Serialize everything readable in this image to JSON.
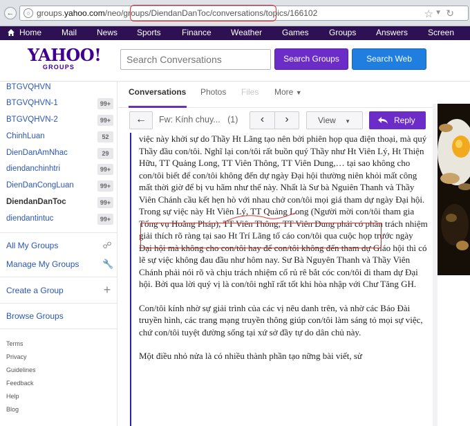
{
  "browser": {
    "url_prefix": "groups.",
    "url_domain": "yahoo.com",
    "url_suffix": "/neo/groups/DiendanDanToc/conversations/topics/166102"
  },
  "topnav": {
    "items": [
      "Home",
      "Mail",
      "News",
      "Sports",
      "Finance",
      "Weather",
      "Games",
      "Groups",
      "Answers",
      "Screen"
    ]
  },
  "header": {
    "logo_text": "YAHOO!",
    "logo_sub": "GROUPS",
    "search_placeholder": "Search Conversations",
    "search_groups_label": "Search Groups",
    "search_web_label": "Search Web"
  },
  "sidebar": {
    "groups": [
      {
        "name": "BTGVQHVN",
        "badge": ""
      },
      {
        "name": "BTGVQHVN-1",
        "badge": "99+"
      },
      {
        "name": "BTGVQHVN-2",
        "badge": "99+"
      },
      {
        "name": "ChinhLuan",
        "badge": "52"
      },
      {
        "name": "DienDanAmNhac",
        "badge": "29"
      },
      {
        "name": "diendanchinhtri",
        "badge": "99+"
      },
      {
        "name": "DienDanCongLuan",
        "badge": "99+"
      },
      {
        "name": "DiendanDanToc",
        "badge": "99+"
      },
      {
        "name": "diendantintuc",
        "badge": "99+"
      }
    ],
    "all_my_groups": "All My Groups",
    "manage_my_groups": "Manage My Groups",
    "create_group": "Create a Group",
    "browse_groups": "Browse Groups",
    "footer": [
      "Terms",
      "Privacy",
      "Guidelines",
      "Feedback",
      "Help",
      "Blog"
    ]
  },
  "tabs": {
    "conversations": "Conversations",
    "photos": "Photos",
    "files": "Files",
    "more": "More"
  },
  "toolbar": {
    "subject": "Fw: Kính chuy...",
    "count": "(1)",
    "view_label": "View",
    "reply_label": "Reply"
  },
  "message": {
    "paragraphs": [
      "việc này khởi sự do Thầy Ht Lãng tạo nên bởi phiên họp qua điện thoại, mà quý Thầy đầu con/tôi.  Nghĩ lại con/tôi rất buồn quý Thầy như Ht Viên Lý, Ht Thiện Hữu, TT Quảng Long, TT Viên Thông, TT Viên Dung,… tại sao không cho con/tôi biết để con/tôi không đến dự ngày Đại hội thường niên khỏi mất công mất thời giờ để bị vu hãm như thế này.  Nhất là Sư bà Nguiên Thanh và Thầy Viên Chánh cầu kết hẹn hò với nhau chở con/tôi mọi giá tham dự ngày Đại hội.  Trong sự việc này Ht Viên Lý, TT Quảng Long (Người mời con/tôi tham gia Tổng vụ Hoằng Pháp), TT Viên Thông, TT Viên Dung phải có phần trách nhiệm giải thích rõ ràng tại sao Ht Trí Lãng tố cáo con/tôi qua cuộc họp trước ngày Đại hội mà không cho con/tôi hay để con/tôi không đến tham dự Giáo hội thì có lẽ sự việc không đau đầu như hôm nay.  Sư Bà Nguyên Thanh và Thầy Viên Chánh phải nói rõ và chịu trách nhiệm cố rủ rê bắt cóc con/tôi đi tham dự Đại hội.  Bởi qua lời quý vị là con/tôi nghĩ rất tốt khi hòa nhập với Chư Tăng GH.",
      "Con/tôi kính nhờ sự giải trình của các vị nêu danh trên, và nhờ các Báo Đài truyền hình, các trang mạng truyền thông giúp con/tôi làm sáng tỏ mọi sự việc, chứ con/tôi tuyệt đường sống tại xứ sở đầy tự do dân chủ này.",
      "Một điều nhỏ nửa là có nhiều thành phần tạo nững bài viết, sử"
    ]
  },
  "colors": {
    "yahoo_purple": "#400090",
    "nav_bg": "#2d1152",
    "accent_purple": "#6b2cc8",
    "accent_blue": "#1f7ee0",
    "link_blue": "#2b56b5",
    "annotation_red": "#e03030"
  }
}
